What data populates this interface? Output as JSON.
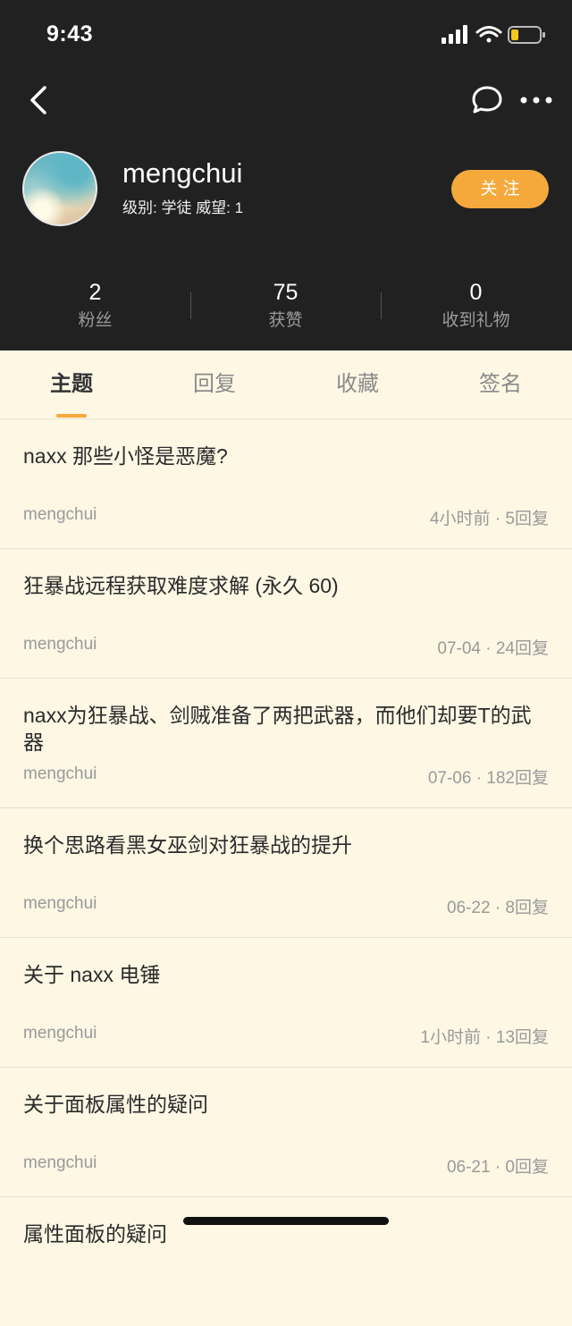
{
  "status_bar": {
    "time": "9:43"
  },
  "profile": {
    "username": "mengchui",
    "meta": "级别: 学徒 威望: 1",
    "follow_label": "关注"
  },
  "stats": [
    {
      "value": "2",
      "label": "粉丝"
    },
    {
      "value": "75",
      "label": "获赞"
    },
    {
      "value": "0",
      "label": "收到礼物"
    }
  ],
  "tabs": [
    {
      "label": "主题",
      "active": true
    },
    {
      "label": "回复"
    },
    {
      "label": "收藏"
    },
    {
      "label": "签名"
    }
  ],
  "posts": [
    {
      "title": "naxx 那些小怪是恶魔?",
      "author": "mengchui",
      "meta": "4小时前 · 5回复"
    },
    {
      "title": "狂暴战远程获取难度求解 (永久 60)",
      "author": "mengchui",
      "meta": "07-04 · 24回复"
    },
    {
      "title": "naxx为狂暴战、剑贼准备了两把武器，而他们却要T的武器",
      "author": "mengchui",
      "meta": "07-06 · 182回复"
    },
    {
      "title": "换个思路看黑女巫剑对狂暴战的提升",
      "author": "mengchui",
      "meta": "06-22 · 8回复"
    },
    {
      "title": "关于 naxx 电锤",
      "author": "mengchui",
      "meta": "1小时前 · 13回复"
    },
    {
      "title": "关于面板属性的疑问",
      "author": "mengchui",
      "meta": "06-21 · 0回复"
    },
    {
      "title": "属性面板的疑问",
      "author": "",
      "meta": ""
    }
  ],
  "colors": {
    "accent": "#f5a93b",
    "header_bg": "#212121",
    "page_bg": "#fdf7e4"
  }
}
